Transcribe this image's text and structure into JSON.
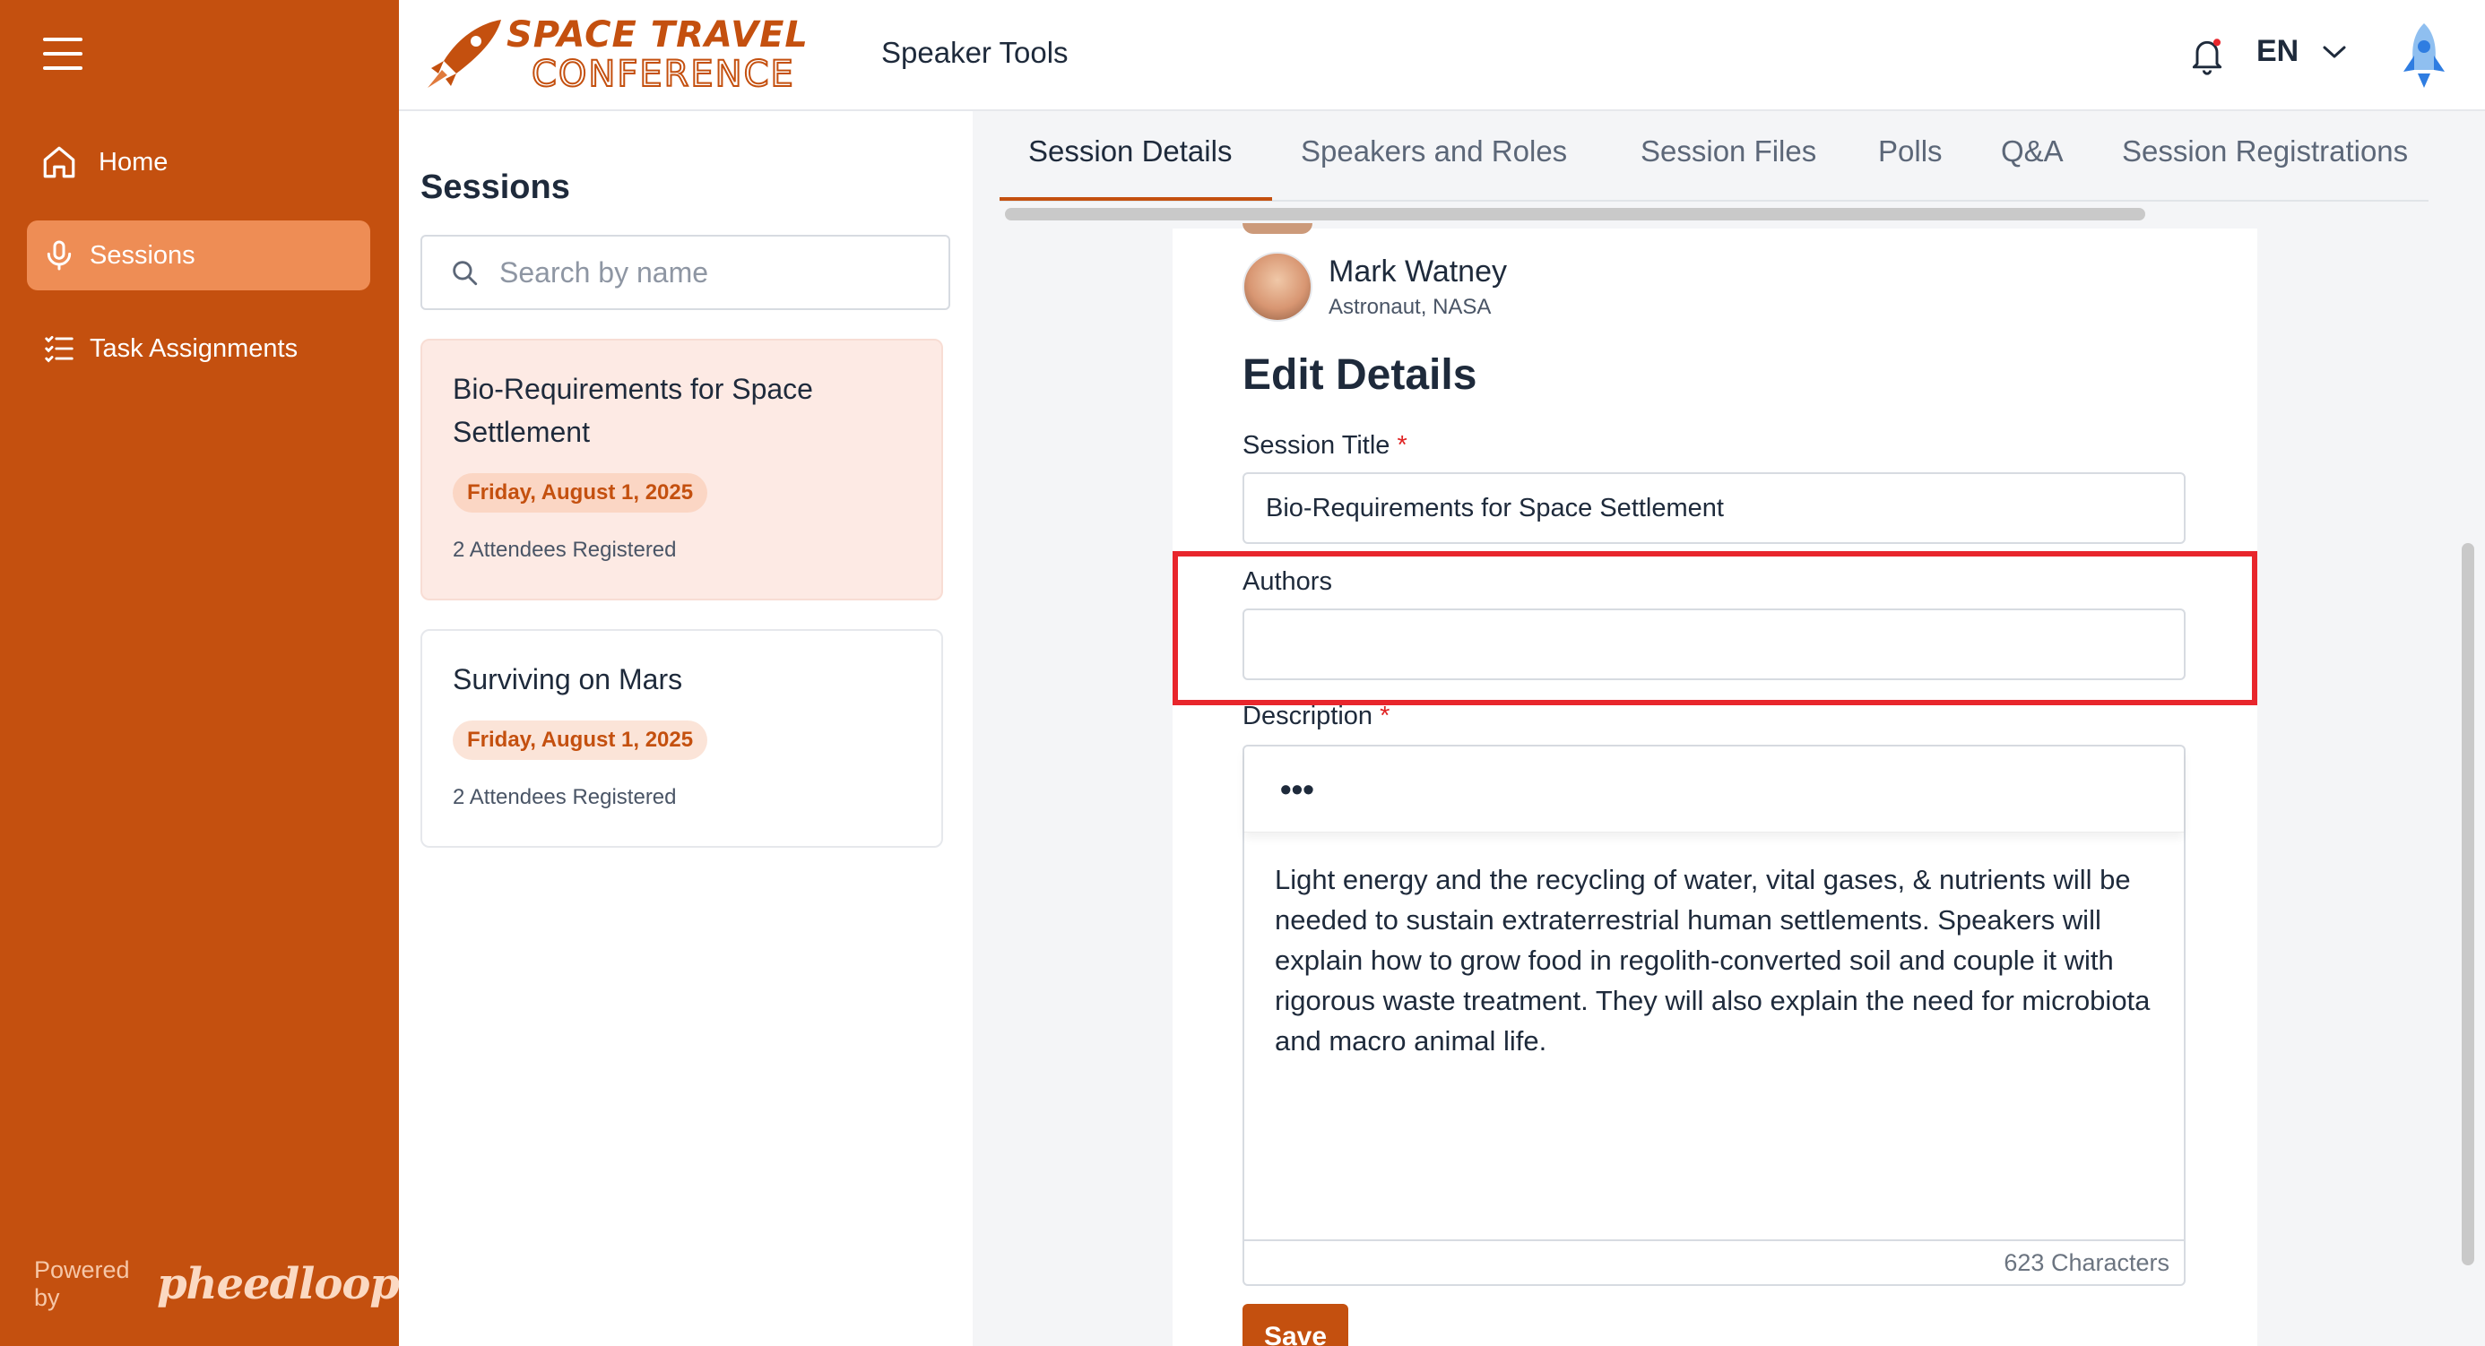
{
  "sidebar": {
    "menu_icon": "hamburger-menu-icon",
    "items": [
      {
        "label": "Home",
        "icon": "home-icon",
        "active": false
      },
      {
        "label": "Sessions",
        "icon": "microphone-icon",
        "active": true
      },
      {
        "label": "Task Assignments",
        "icon": "checklist-icon",
        "active": false
      }
    ],
    "powered_by": "Powered by",
    "powered_brand": "pheedloop"
  },
  "header": {
    "logo_line1": "SPACE TRAVEL",
    "logo_line2": "CONFERENCE",
    "title": "Speaker Tools",
    "language": "EN",
    "notification_icon": "bell-icon",
    "avatar_icon": "rocket-avatar-icon"
  },
  "sessions": {
    "title": "Sessions",
    "search_placeholder": "Search by name",
    "list": [
      {
        "title": "Bio-Requirements for Space Settlement",
        "date": "Friday, August 1, 2025",
        "attendees": "2 Attendees Registered",
        "active": true
      },
      {
        "title": "Surviving on Mars",
        "date": "Friday, August 1, 2025",
        "attendees": "2 Attendees Registered",
        "active": false
      }
    ]
  },
  "tabs": [
    "Session Details",
    "Speakers and Roles",
    "Session Files",
    "Polls",
    "Q&A",
    "Session Registrations"
  ],
  "detail": {
    "speaker_name": "Mark Watney",
    "speaker_role": "Astronaut, NASA",
    "edit_title": "Edit Details",
    "session_title_label": "Session Title",
    "session_title_value": "Bio-Requirements for Space Settlement",
    "authors_label": "Authors",
    "authors_value": "",
    "description_label": "Description",
    "required_mark": "*",
    "toolbar_more": "•••",
    "description": "Light energy and the recycling of water, vital gases, & nutrients will be needed to sustain extraterrestrial human settlements. Speakers will explain how to grow food in regolith-converted soil and couple it with rigorous waste treatment. They will also explain the need for microbiota and macro animal life.",
    "char_count": "623 Characters",
    "save_label": "Save"
  },
  "colors": {
    "brand": "#c4500f",
    "highlight": "#e8262c"
  }
}
